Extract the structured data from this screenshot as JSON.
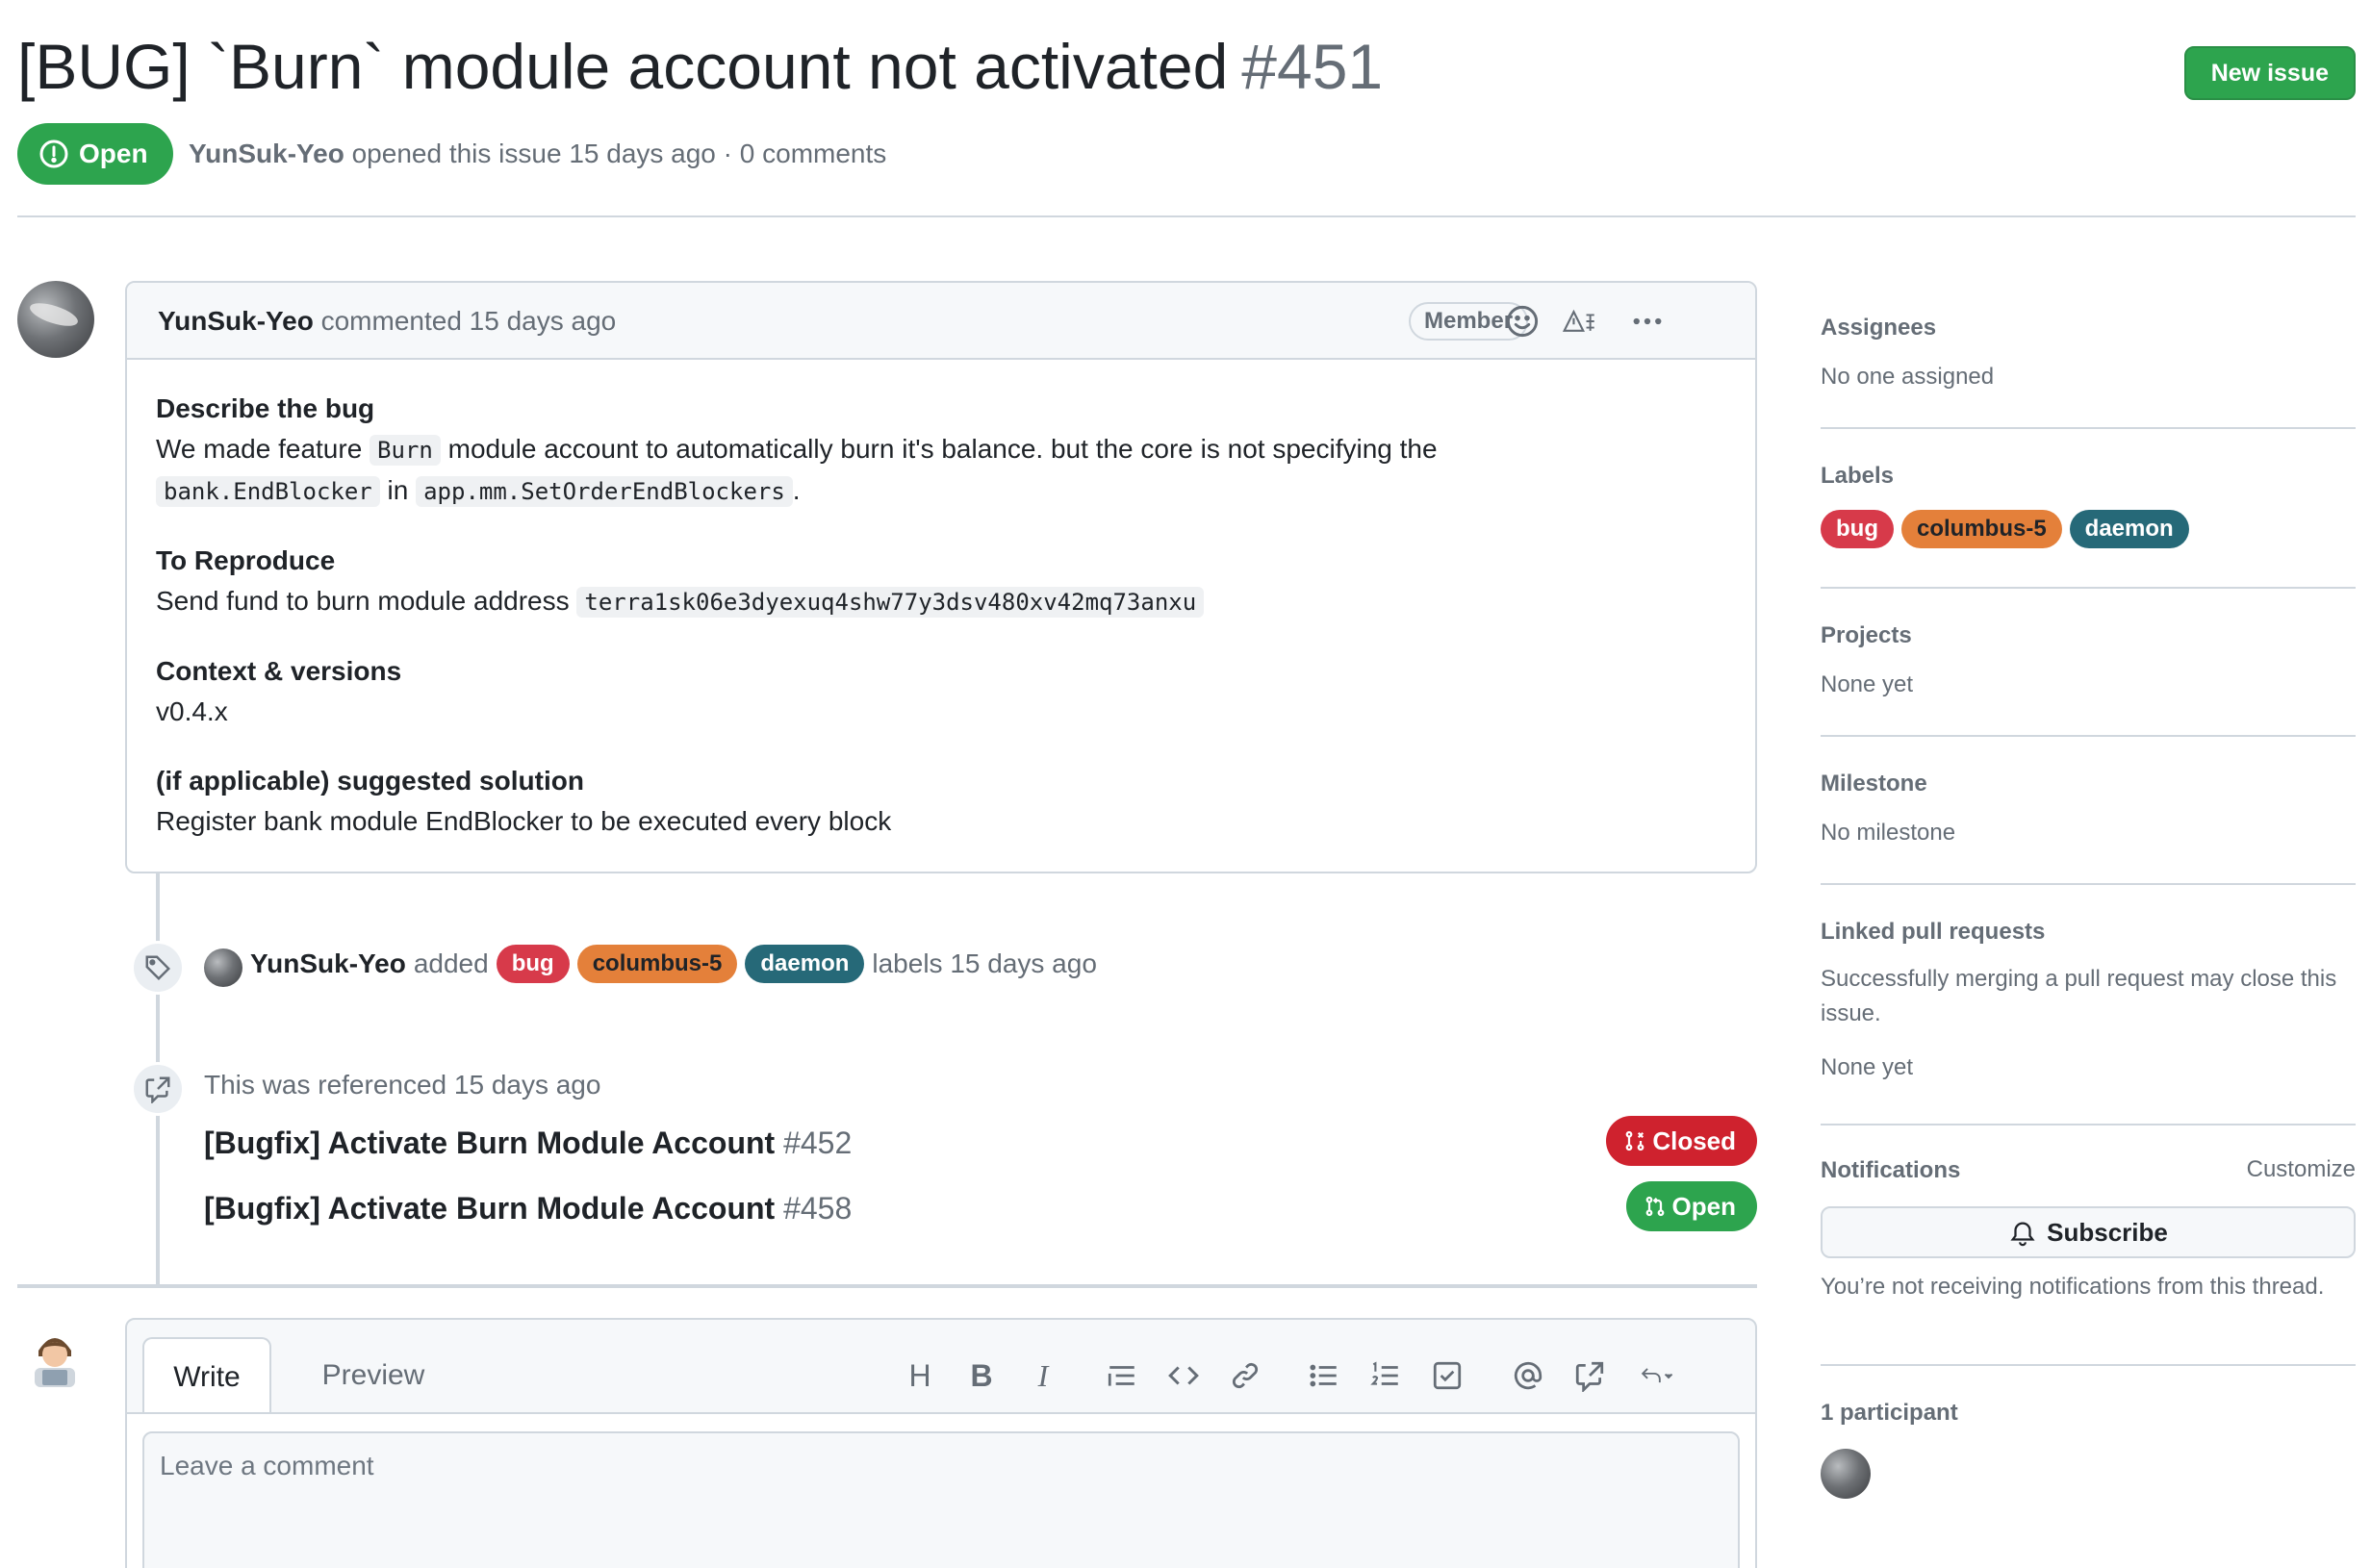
{
  "issue": {
    "title": "[BUG] `Burn` module account not activated",
    "number": "#451",
    "state": "Open",
    "author": "YunSuk-Yeo",
    "meta_text": "opened this issue 15 days ago · 0 comments",
    "new_issue_label": "New issue"
  },
  "comment": {
    "author": "YunSuk-Yeo",
    "time_text": "commented 15 days ago",
    "role_badge": "Member",
    "sections": {
      "bug_heading": "Describe the bug",
      "bug_text_1": "We made feature",
      "bug_code_1": "Burn",
      "bug_text_2": "module account to automatically burn it's balance. but the core is not specifying the",
      "bug_code_2": "bank.EndBlocker",
      "bug_text_3": "in",
      "bug_code_3": "app.mm.SetOrderEndBlockers",
      "bug_text_4": ".",
      "repro_heading": "To Reproduce",
      "repro_text": "Send fund to burn module address",
      "repro_code": "terra1sk06e3dyexuq4shw77y3dsv480xv42mq73anxu",
      "context_heading": "Context & versions",
      "context_text": "v0.4.x",
      "solution_heading": "(if applicable) suggested solution",
      "solution_text": "Register bank module EndBlocker to be executed every block"
    }
  },
  "timeline": {
    "label_event": {
      "author": "YunSuk-Yeo",
      "action": "added",
      "suffix": "labels 15 days ago"
    },
    "reference_event": {
      "text": "This was referenced 15 days ago",
      "items": [
        {
          "title": "[Bugfix] Activate Burn Module Account",
          "number": "#452",
          "state": "Closed"
        },
        {
          "title": "[Bugfix] Activate Burn Module Account",
          "number": "#458",
          "state": "Open"
        }
      ]
    }
  },
  "labels": [
    {
      "name": "bug",
      "color": "#d73a4a"
    },
    {
      "name": "columbus-5",
      "color": "#e4803a"
    },
    {
      "name": "daemon",
      "color": "#266978"
    }
  ],
  "composer": {
    "tab_write": "Write",
    "tab_preview": "Preview",
    "heading_tool": "H",
    "bold_tool": "B",
    "italic_tool": "I",
    "placeholder": "Leave a comment"
  },
  "sidebar": {
    "assignees": {
      "heading": "Assignees",
      "value": "No one assigned"
    },
    "labels_heading": "Labels",
    "projects": {
      "heading": "Projects",
      "value": "None yet"
    },
    "milestone": {
      "heading": "Milestone",
      "value": "No milestone"
    },
    "linked_prs": {
      "heading": "Linked pull requests",
      "description": "Successfully merging a pull request may close this issue.",
      "value": "None yet"
    },
    "notifications": {
      "heading": "Notifications",
      "customize": "Customize",
      "subscribe": "Subscribe",
      "description": "You’re not receiving notifications from this thread."
    },
    "participants": {
      "heading": "1 participant"
    }
  },
  "colors": {
    "open_green": "#2da44e",
    "closed_red": "#cf222e",
    "border": "#d0d7de",
    "muted_text": "#656d76"
  }
}
